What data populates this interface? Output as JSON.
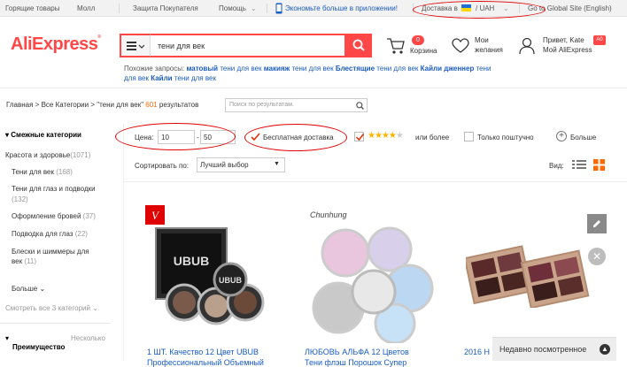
{
  "topbar": {
    "hot": "Горящие товары",
    "mall": "Молл",
    "protection": "Защита Покупателя",
    "help": "Помощь",
    "app": "Экономьте больше в приложении!",
    "delivery": "Доставка в",
    "currency": "/ UAH",
    "global": "Go to Global Site (English)"
  },
  "header": {
    "logo": "AliExpress",
    "search_value": "тени для век",
    "cart_count": "0",
    "cart_label": "Корзина",
    "wish_label1": "Мои",
    "wish_label2": "желания",
    "greeting": "Привет, Kate",
    "my_ali": "Мой AliExpress",
    "badge": "A0",
    "related_prefix": "Похожие запросы:",
    "related": [
      {
        "bold": "матовый",
        "rest": "тени для век"
      },
      {
        "bold": "макияж",
        "rest": "тени для век"
      },
      {
        "bold": "Блестящие",
        "rest": "тени для век"
      },
      {
        "bold": "Кайли дженнер",
        "rest": "тени для век"
      },
      {
        "bold": "Кайли",
        "rest": "тени для век"
      }
    ]
  },
  "breadcrumb": {
    "home": "Главная",
    "all": "Все Категории",
    "query": "\"тени для век\"",
    "count": "601",
    "results": "результатов",
    "search_in_placeholder": "Поиск по результатам."
  },
  "sidebar": {
    "title": "Смежные категории",
    "parent": "Красота и здоровье",
    "parent_count": "(1071)",
    "items": [
      {
        "label": "Тени для век",
        "count": "(168)"
      },
      {
        "label": "Тени для глаз и подводки",
        "count": "(132)"
      },
      {
        "label": "Оформление бровей",
        "count": "(37)"
      },
      {
        "label": "Подводка для глаз",
        "count": "(22)"
      },
      {
        "label": "Блески и шиммеры для век",
        "count": "(11)"
      }
    ],
    "more": "Больше",
    "see_all": "Смотреть все 3 категорий",
    "advantage": "Преимущество",
    "multiple": "Несколько"
  },
  "filters": {
    "price_label": "Цена:",
    "price_from": "10",
    "price_dash": "-",
    "price_to": "50",
    "free_shipping": "Бесплатная доставка",
    "rating_more": "или более",
    "single": "Только поштучно",
    "more": "Больше"
  },
  "sort": {
    "label": "Сортировать по:",
    "value": "Лучший выбор",
    "view_label": "Вид:"
  },
  "products": [
    {
      "title": "1 ШТ. Качество 12 Цвет UBUB",
      "title2": "Профессиональный Объемный",
      "brand": "UBUB"
    },
    {
      "title": "ЛЮБОВЬ АЛЬФА 12 Цветов",
      "title2": "Тени флэш Порошок Супер",
      "brand": "Chunhung"
    },
    {
      "title": "2016 Н",
      "title2": "",
      "brand": ""
    }
  ],
  "recently_viewed": "Недавно посмотренное"
}
